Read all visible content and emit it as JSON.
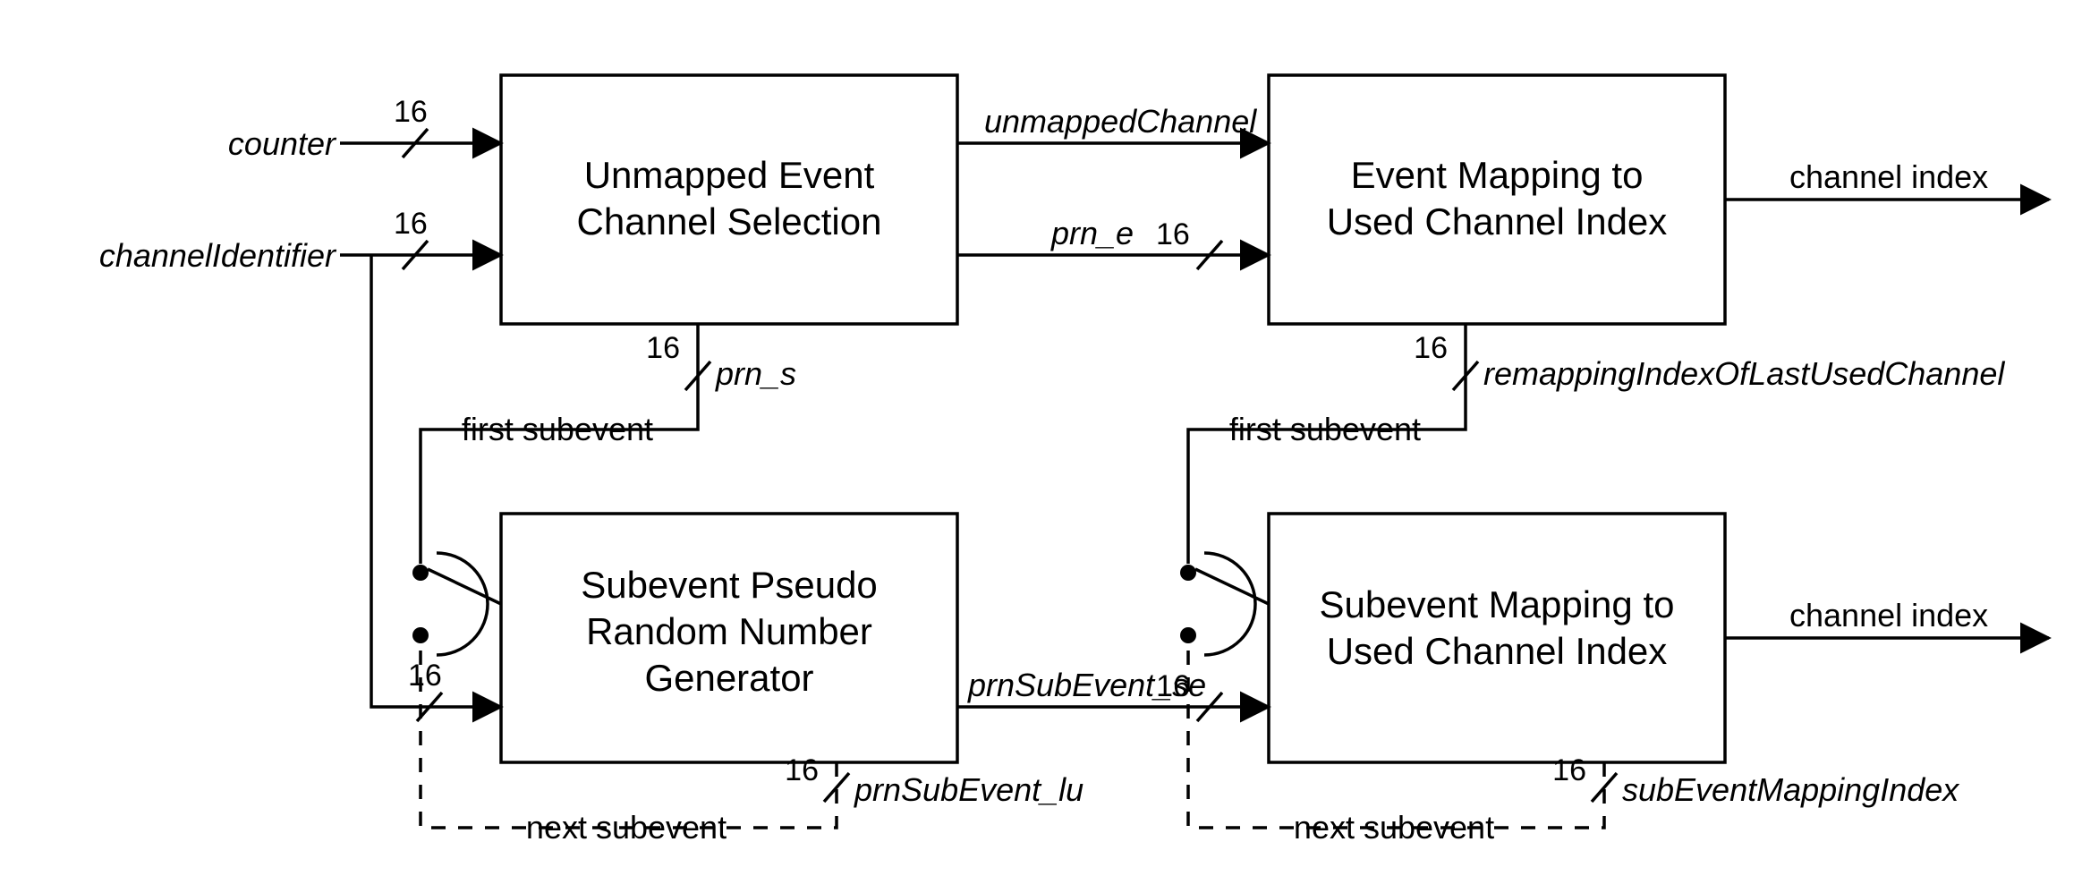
{
  "inputs": {
    "counter": "counter",
    "channelIdentifier": "channelIdentifier"
  },
  "blocks": {
    "unmapped": {
      "line1": "Unmapped Event",
      "line2": "Channel Selection"
    },
    "eventMap": {
      "line1": "Event Mapping to",
      "line2": "Used Channel Index"
    },
    "subPrng": {
      "line1": "Subevent Pseudo",
      "line2": "Random Number",
      "line3": "Generator"
    },
    "subMap": {
      "line1": "Subevent Mapping to",
      "line2": "Used Channel Index"
    }
  },
  "signals": {
    "unmappedChannel": "unmappedChannel",
    "prn_e": "prn_e",
    "prn_s": "prn_s",
    "prnSubEvent_se": "prnSubEvent_se",
    "prnSubEvent_lu": "prnSubEvent_lu",
    "remappingIndexOfLastUsedChannel": "remappingIndexOfLastUsedChannel",
    "subEventMappingIndex": "subEventMappingIndex",
    "channelIndex1": "channel index",
    "channelIndex2": "channel index",
    "firstSubevent1": "first subevent",
    "firstSubevent2": "first subevent",
    "nextSubevent1": "next subevent",
    "nextSubevent2": "next subevent"
  },
  "widths": {
    "w16": "16"
  }
}
